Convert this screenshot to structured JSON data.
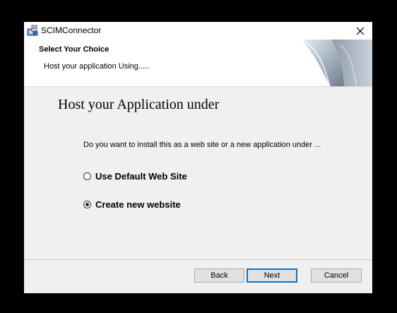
{
  "window": {
    "title": "SCIMConnector"
  },
  "banner": {
    "title": "Select Your Choice",
    "subtitle": "Host your application Using....."
  },
  "main": {
    "heading": "Host your Application under",
    "question": "Do you want to install this as a web site or a new application under ...",
    "options": [
      {
        "label": "Use Default Web Site",
        "checked": false
      },
      {
        "label": "Create new website",
        "checked": true
      }
    ]
  },
  "footer": {
    "back_label": "Back",
    "next_label": "Next",
    "cancel_label": "Cancel"
  },
  "colors": {
    "accent": "#0078d7",
    "window_bg": "#f0f0f0",
    "button_bg": "#e1e1e1"
  },
  "icons": {
    "app": "installer-icon",
    "close": "close-icon",
    "banner": "page-curl-graphic"
  }
}
